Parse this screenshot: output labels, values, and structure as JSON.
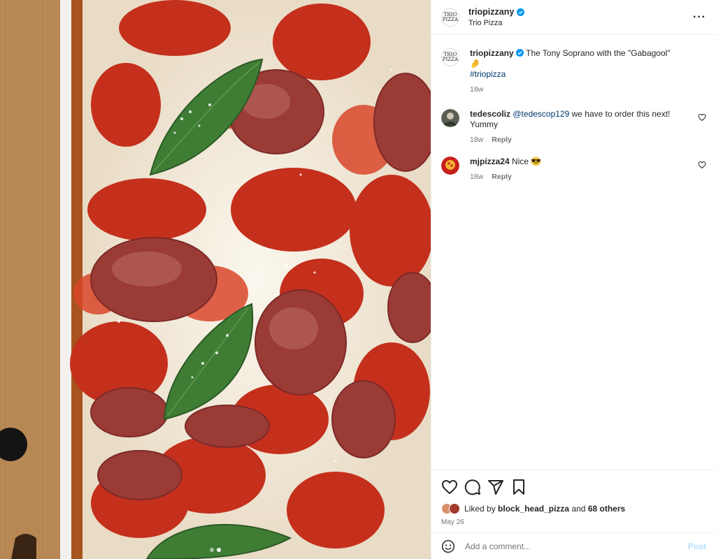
{
  "media": {
    "carousel_total": 2,
    "carousel_active": 2
  },
  "header": {
    "username": "triopizzany",
    "subtitle": "Trio Pizza",
    "avatar_text": "TRIO PIZZA",
    "more_label": "···"
  },
  "caption": {
    "username": "triopizzany",
    "text": "The Tony Soprano with the \"Gabagool\" 🤌",
    "hashtag": "#triopizza",
    "time": "18w"
  },
  "comments": [
    {
      "username": "tedescoliz",
      "mention": "@tedescop129",
      "text": " we have to order this next! Yummy",
      "time": "18w",
      "reply_label": "Reply"
    },
    {
      "username": "mjpizza24",
      "mention": "",
      "text": "Nice 😎",
      "time": "18w",
      "reply_label": "Reply"
    }
  ],
  "likes": {
    "prefix": "Liked by ",
    "user": "block_head_pizza",
    "middle": " and ",
    "others": "68 others"
  },
  "date": "May 26",
  "add_comment": {
    "placeholder": "Add a comment...",
    "post_label": "Post"
  },
  "icons": {
    "like": "heart-icon",
    "comment": "comment-icon",
    "share": "share-icon",
    "save": "bookmark-icon",
    "emoji": "emoji-icon",
    "verified": "verified-badge-icon"
  },
  "colors": {
    "link": "#00376b",
    "verified": "#0095f6",
    "post_disabled": "#b2dffc",
    "muted": "#737373"
  }
}
